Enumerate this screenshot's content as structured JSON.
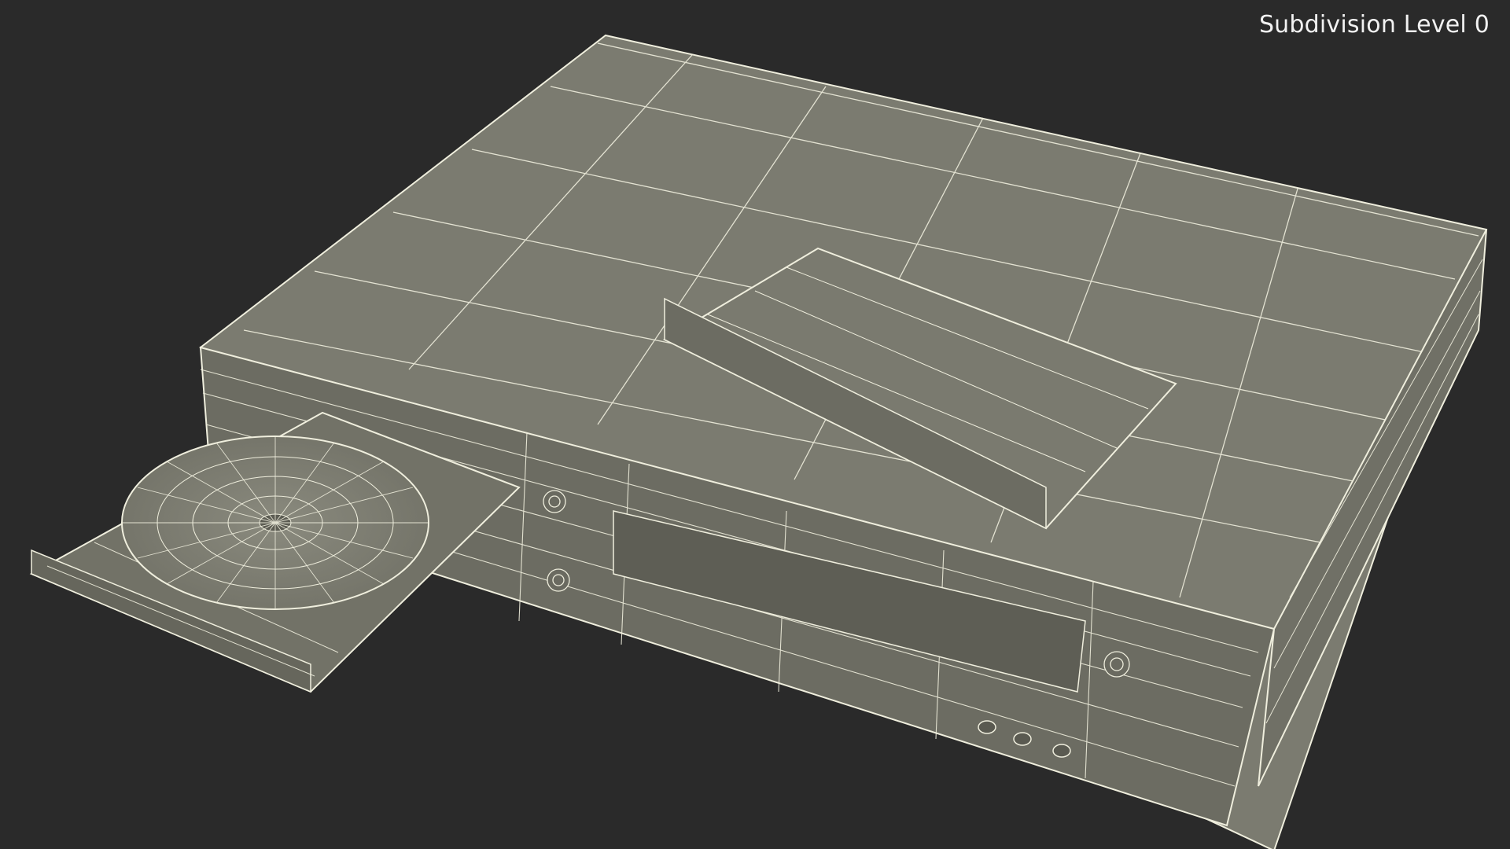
{
  "viewport": {
    "label": "Subdivision Level 0"
  },
  "colors": {
    "background": "#2a2a2a",
    "surface": "#7b7b70",
    "surface_dark": "#66665c",
    "surface_light": "#8a8a7e",
    "wire": "#efeedd"
  },
  "icons": {
    "screw_head": "screw-icon",
    "disc": "disc-icon"
  }
}
